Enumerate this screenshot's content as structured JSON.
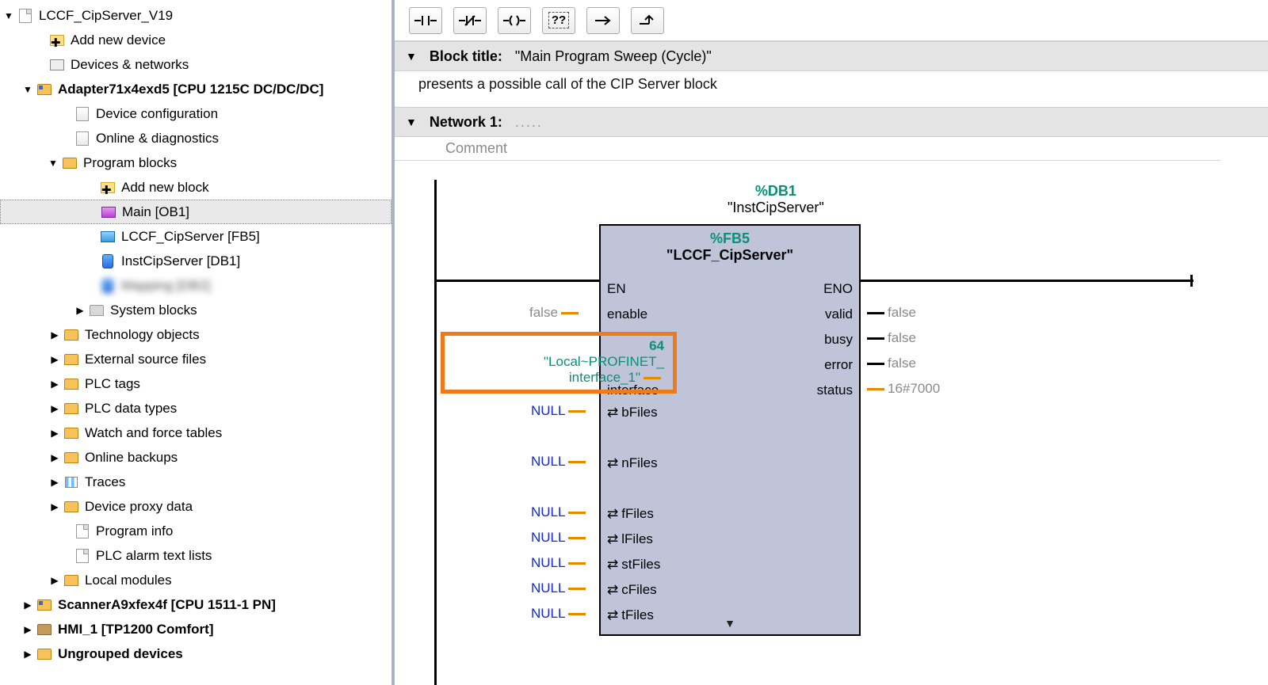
{
  "tree": {
    "project": "LCCF_CipServer_V19",
    "add_device": "Add new device",
    "devnet": "Devices & networks",
    "plc": "Adapter71x4exd5 [CPU 1215C DC/DC/DC]",
    "devconf": "Device configuration",
    "online": "Online & diagnostics",
    "progblocks": "Program blocks",
    "addblock": "Add new block",
    "main": "Main [OB1]",
    "fb": "LCCF_CipServer [FB5]",
    "db": "InstCipServer [DB1]",
    "blurred": "Mapping [DB2]",
    "sysblocks": "System blocks",
    "tech": "Technology objects",
    "extsrc": "External source files",
    "plctags": "PLC tags",
    "plcdt": "PLC data types",
    "watch": "Watch and force tables",
    "backup": "Online backups",
    "traces": "Traces",
    "proxy": "Device proxy data",
    "proginfo": "Program info",
    "alarm": "PLC alarm text lists",
    "localmod": "Local modules",
    "scanner": "ScannerA9xfex4f [CPU 1511-1 PN]",
    "hmi": "HMI_1 [TP1200 Comfort]",
    "ungrouped": "Ungrouped devices"
  },
  "toolbar": {
    "t1": "NO contact",
    "t2": "NC contact",
    "t3": "Coil",
    "t4": "Empty box",
    "t5": "Open branch",
    "t6": "Close branch"
  },
  "block": {
    "title_label": "Block title:",
    "title_value": "\"Main Program Sweep (Cycle)\"",
    "desc": "presents a possible call of the CIP Server block",
    "network_label": "Network 1:",
    "comment_placeholder": "Comment"
  },
  "fb": {
    "db_id": "%DB1",
    "db_name": "\"InstCipServer\"",
    "fb_id": "%FB5",
    "fb_name": "LCCF_CipServer",
    "in": {
      "en": "EN",
      "enable": "enable",
      "interface": "interface",
      "bFiles": "bFiles",
      "nFiles": "nFiles",
      "fFiles": "fFiles",
      "lFiles": "lFiles",
      "stFiles": "stFiles",
      "cFiles": "cFiles",
      "tFiles": "tFiles"
    },
    "out": {
      "eno": "ENO",
      "valid": "valid",
      "busy": "busy",
      "error": "error",
      "status": "status"
    },
    "vals": {
      "enable": "false",
      "interface_num": "64",
      "interface_name": "\"Local~PROFINET_",
      "interface_name2": "interface_1\"",
      "null": "NULL",
      "valid": "false",
      "busy": "false",
      "error": "false",
      "status": "16#7000"
    }
  }
}
